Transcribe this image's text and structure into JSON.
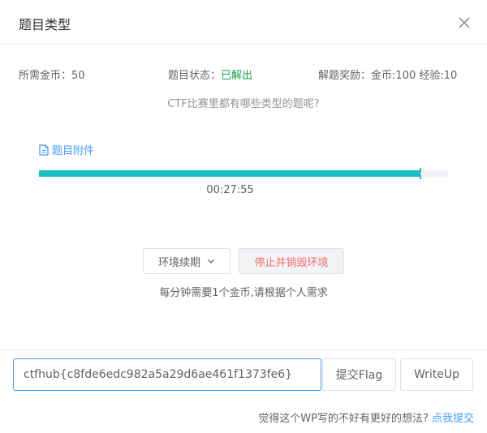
{
  "dialog": {
    "title": "题目类型",
    "close_icon": "close-icon"
  },
  "info": {
    "cost_label": "所需金币：",
    "cost_value": "50",
    "status_label": "题目状态：",
    "status_value": "已解出",
    "reward_label": "解题奖励：",
    "reward_value": "金币:100 经验:10"
  },
  "question": "CTF比赛里都有哪些类型的题呢?",
  "attachment": {
    "icon": "document-icon",
    "label": "题目附件"
  },
  "timer": {
    "remaining": "00:27:55",
    "progress_fraction": 0.932
  },
  "buttons": {
    "renew_label": "环境续期",
    "destroy_label": "停止并销毁环境"
  },
  "cost_note": "每分钟需要1个金币,请根据个人需求",
  "flag": {
    "value": "ctfhub{c8fde6edc982a5a29d6ae461f1373fe6}",
    "submit_label": "提交Flag",
    "writeup_label": "WriteUp"
  },
  "feedback": {
    "text": "觉得这个WP写的不好有更好的想法?",
    "link_label": "点我提交"
  },
  "colors": {
    "accent": "#409eff",
    "progress": "#1abfc0",
    "solved": "#16a34a",
    "danger": "#f56c6c"
  }
}
